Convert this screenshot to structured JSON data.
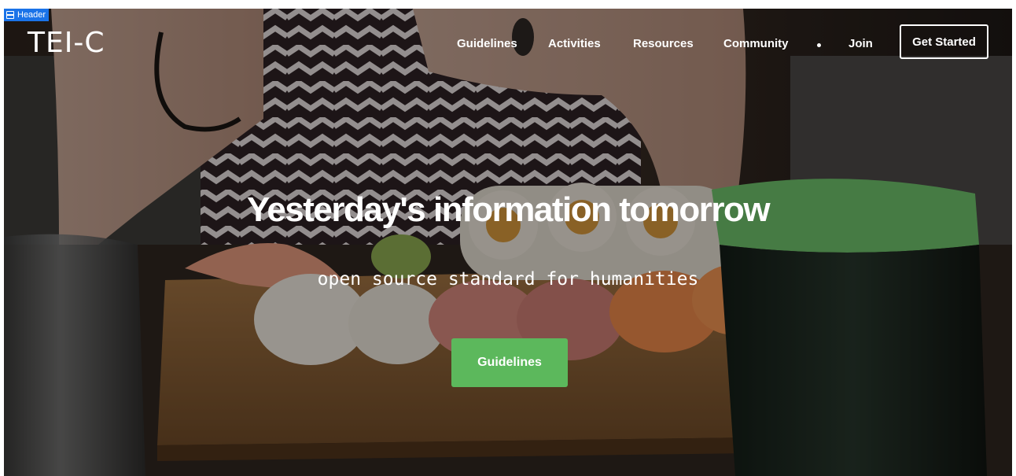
{
  "editor": {
    "tag_label": "Header"
  },
  "header": {
    "logo": "TEI-C",
    "nav": [
      {
        "label": "Guidelines"
      },
      {
        "label": "Activities"
      },
      {
        "label": "Resources"
      },
      {
        "label": "Community"
      },
      {
        "label": "Join"
      }
    ],
    "cta_label": "Get Started"
  },
  "hero": {
    "title": "Yesterday's information tomorrow",
    "subtitle": "open source standard for humanities",
    "button_label": "Guidelines"
  },
  "colors": {
    "accent_green": "#5cb85c",
    "editor_blue": "#1a73e8",
    "text": "#ffffff"
  }
}
